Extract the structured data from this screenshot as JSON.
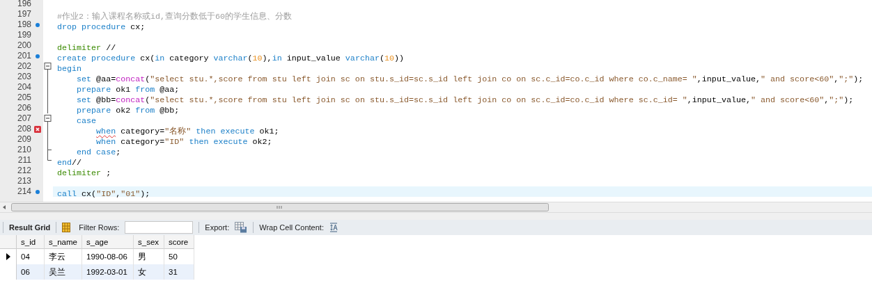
{
  "editor": {
    "lines": [
      {
        "number": "196",
        "current": false
      },
      {
        "number": "197",
        "current": false,
        "tokens": [
          {
            "kind": "comment",
            "text": "#作业2：输入课程名称或id,查询分数低于60的学生信息、分数"
          }
        ]
      },
      {
        "number": "198",
        "current": false,
        "marker": {
          "kind": "dot"
        },
        "tokens": [
          {
            "kind": "keyword",
            "text": "drop procedure"
          },
          {
            "kind": "plain",
            "text": " cx;"
          }
        ]
      },
      {
        "number": "199",
        "current": false
      },
      {
        "number": "200",
        "current": false,
        "tokens": [
          {
            "kind": "delimiter",
            "text": "delimiter"
          },
          {
            "kind": "plain",
            "text": " //"
          }
        ]
      },
      {
        "number": "201",
        "current": false,
        "marker": {
          "kind": "dot"
        },
        "tokens": [
          {
            "kind": "keyword",
            "text": "create procedure"
          },
          {
            "kind": "plain",
            "text": " cx("
          },
          {
            "kind": "keyword",
            "text": "in"
          },
          {
            "kind": "plain",
            "text": " category "
          },
          {
            "kind": "keyword",
            "text": "varchar"
          },
          {
            "kind": "plain",
            "text": "("
          },
          {
            "kind": "number",
            "text": "10"
          },
          {
            "kind": "plain",
            "text": "),"
          },
          {
            "kind": "keyword",
            "text": "in"
          },
          {
            "kind": "plain",
            "text": " input_value "
          },
          {
            "kind": "keyword",
            "text": "varchar"
          },
          {
            "kind": "plain",
            "text": "("
          },
          {
            "kind": "number",
            "text": "10"
          },
          {
            "kind": "plain",
            "text": "))"
          }
        ]
      },
      {
        "number": "202",
        "current": false,
        "fold": {
          "kind": "box"
        },
        "tokens": [
          {
            "kind": "keyword",
            "text": "begin"
          }
        ]
      },
      {
        "number": "203",
        "current": false,
        "fold": {
          "kind": "line"
        },
        "tokens": [
          {
            "kind": "keyword",
            "text": "    set"
          },
          {
            "kind": "plain",
            "text": " @aa="
          },
          {
            "kind": "function",
            "text": "concat"
          },
          {
            "kind": "plain",
            "text": "("
          },
          {
            "kind": "string",
            "text": "\"select stu.*,score from stu left join sc on stu.s_id=sc.s_id left join co on sc.c_id=co.c_id where co.c_name= \""
          },
          {
            "kind": "plain",
            "text": ",input_value,"
          },
          {
            "kind": "string",
            "text": "\" and score<60\""
          },
          {
            "kind": "plain",
            "text": ","
          },
          {
            "kind": "string",
            "text": "\";\""
          },
          {
            "kind": "plain",
            "text": ");"
          }
        ]
      },
      {
        "number": "204",
        "current": false,
        "fold": {
          "kind": "line"
        },
        "tokens": [
          {
            "kind": "keyword",
            "text": "    prepare"
          },
          {
            "kind": "plain",
            "text": " ok1 "
          },
          {
            "kind": "keyword",
            "text": "from"
          },
          {
            "kind": "plain",
            "text": " @aa;"
          }
        ]
      },
      {
        "number": "205",
        "current": false,
        "fold": {
          "kind": "line"
        },
        "tokens": [
          {
            "kind": "keyword",
            "text": "    set"
          },
          {
            "kind": "plain",
            "text": " @bb="
          },
          {
            "kind": "function",
            "text": "concat"
          },
          {
            "kind": "plain",
            "text": "("
          },
          {
            "kind": "string",
            "text": "\"select stu.*,score from stu left join sc on stu.s_id=sc.s_id left join co on sc.c_id=co.c_id where sc.c_id= \""
          },
          {
            "kind": "plain",
            "text": ",input_value,"
          },
          {
            "kind": "string",
            "text": "\" and score<60\""
          },
          {
            "kind": "plain",
            "text": ","
          },
          {
            "kind": "string",
            "text": "\";\""
          },
          {
            "kind": "plain",
            "text": ");"
          }
        ]
      },
      {
        "number": "206",
        "current": false,
        "fold": {
          "kind": "line"
        },
        "tokens": [
          {
            "kind": "keyword",
            "text": "    prepare"
          },
          {
            "kind": "plain",
            "text": " ok2 "
          },
          {
            "kind": "keyword",
            "text": "from"
          },
          {
            "kind": "plain",
            "text": " @bb;"
          }
        ]
      },
      {
        "number": "207",
        "current": false,
        "fold": {
          "kind": "box"
        },
        "tokens": [
          {
            "kind": "keyword",
            "text": "    case"
          }
        ]
      },
      {
        "number": "208",
        "current": false,
        "marker": {
          "kind": "error"
        },
        "fold": {
          "kind": "line"
        },
        "tokens": [
          {
            "kind": "error",
            "text": "        when"
          },
          {
            "kind": "plain",
            "text": " category="
          },
          {
            "kind": "string",
            "text": "\"名称\""
          },
          {
            "kind": "keyword",
            "text": " then execute"
          },
          {
            "kind": "plain",
            "text": " ok1;"
          }
        ]
      },
      {
        "number": "209",
        "current": false,
        "fold": {
          "kind": "line"
        },
        "tokens": [
          {
            "kind": "keyword",
            "text": "        when"
          },
          {
            "kind": "plain",
            "text": " category="
          },
          {
            "kind": "string",
            "text": "\"ID\""
          },
          {
            "kind": "keyword",
            "text": " then execute"
          },
          {
            "kind": "plain",
            "text": " ok2;"
          }
        ]
      },
      {
        "number": "210",
        "current": false,
        "fold": {
          "kind": "tee"
        },
        "tokens": [
          {
            "kind": "keyword",
            "text": "    end case"
          },
          {
            "kind": "plain",
            "text": ";"
          }
        ]
      },
      {
        "number": "211",
        "current": false,
        "fold": {
          "kind": "corner"
        },
        "tokens": [
          {
            "kind": "keyword",
            "text": "end"
          },
          {
            "kind": "plain",
            "text": "//"
          }
        ]
      },
      {
        "number": "212",
        "current": false,
        "tokens": [
          {
            "kind": "delimiter",
            "text": "delimiter"
          },
          {
            "kind": "plain",
            "text": " ;"
          }
        ]
      },
      {
        "number": "213",
        "current": false
      },
      {
        "number": "214",
        "current": true,
        "marker": {
          "kind": "dot"
        },
        "tokens": [
          {
            "kind": "keyword",
            "text": "call"
          },
          {
            "kind": "plain",
            "text": " cx("
          },
          {
            "kind": "string",
            "text": "\"ID\""
          },
          {
            "kind": "plain",
            "text": ","
          },
          {
            "kind": "string",
            "text": "\"01\""
          },
          {
            "kind": "plain",
            "text": ");"
          }
        ]
      }
    ]
  },
  "toolbar": {
    "result_tab": "Result Grid",
    "filter_label": "Filter Rows:",
    "export_label": "Export:",
    "wrap_label": "Wrap Cell Content:"
  },
  "grid": {
    "columns": [
      "s_id",
      "s_name",
      "s_age",
      "s_sex",
      "score"
    ],
    "rows": [
      {
        "selected": true,
        "cells": [
          "04",
          "李云",
          "1990-08-06",
          "男",
          "50"
        ]
      },
      {
        "selected": false,
        "cells": [
          "06",
          "吴兰",
          "1992-03-01",
          "女",
          "31"
        ]
      }
    ]
  }
}
